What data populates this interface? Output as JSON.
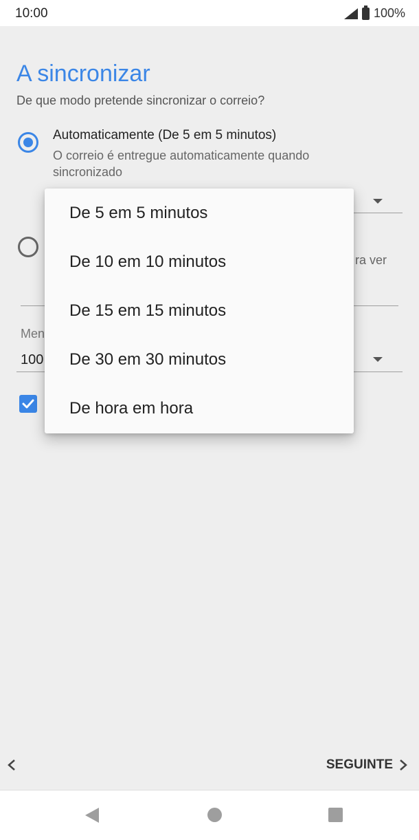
{
  "status": {
    "time": "10:00",
    "battery": "100%"
  },
  "page": {
    "title": "A sincronizar",
    "subtitle": "De que modo pretende sincronizar o correio?"
  },
  "options": {
    "auto": {
      "title": "Automaticamente (De 5 em 5 minutos)",
      "description": "O correio é entregue automaticamente quando sincronizado",
      "selected": true
    },
    "manual": {
      "partial_text": "ra ver",
      "selected": false
    }
  },
  "mail_field": {
    "label_partial": "Men",
    "value_partial": "100"
  },
  "checkbox": {
    "checked": true
  },
  "dropdown_menu": {
    "items": [
      "De 5 em 5 minutos",
      "De 10 em 10 minutos",
      "De 15 em 15 minutos",
      "De 30 em 30 minutos",
      "De hora em hora"
    ]
  },
  "footer": {
    "prev_label": "<",
    "next_label": "SEGUINTE"
  },
  "colors": {
    "accent": "#3b86e6",
    "background": "#eeeeee",
    "menu": "#fafafa"
  }
}
